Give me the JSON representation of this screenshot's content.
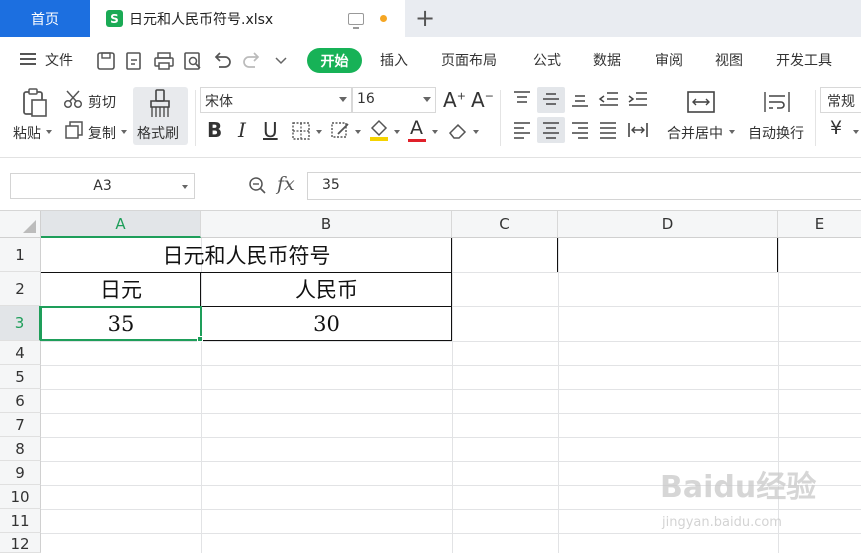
{
  "tabs": {
    "home": "首页",
    "file_name": "日元和人民币符号.xlsx"
  },
  "menu": {
    "file": "文件",
    "items": [
      "开始",
      "插入",
      "页面布局",
      "公式",
      "数据",
      "审阅",
      "视图",
      "开发工具"
    ]
  },
  "ribbon": {
    "paste": "粘贴",
    "cut": "剪切",
    "copy": "复制",
    "format_painter": "格式刷",
    "font_name": "宋体",
    "font_size": "16",
    "merge_center": "合并居中",
    "wrap_text": "自动换行",
    "number_format": "常规"
  },
  "formula_bar": {
    "name_box": "A3",
    "fx": "fx",
    "value": "35"
  },
  "sheet": {
    "columns": [
      "A",
      "B",
      "C",
      "D",
      "E"
    ],
    "rows": [
      "1",
      "2",
      "3",
      "4",
      "5",
      "6",
      "7",
      "8",
      "9",
      "10",
      "11",
      "12"
    ],
    "cells": {
      "title": "日元和人民币符号",
      "a2": "日元",
      "b2": "人民币",
      "a3": "35",
      "b3": "30"
    }
  },
  "colors": {
    "accent_green": "#17b257",
    "home_tab_blue": "#1c6fe0",
    "selection_green": "#1e9e5a"
  },
  "watermark": {
    "main": "Baidu经验",
    "sub": "jingyan.baidu.com"
  }
}
